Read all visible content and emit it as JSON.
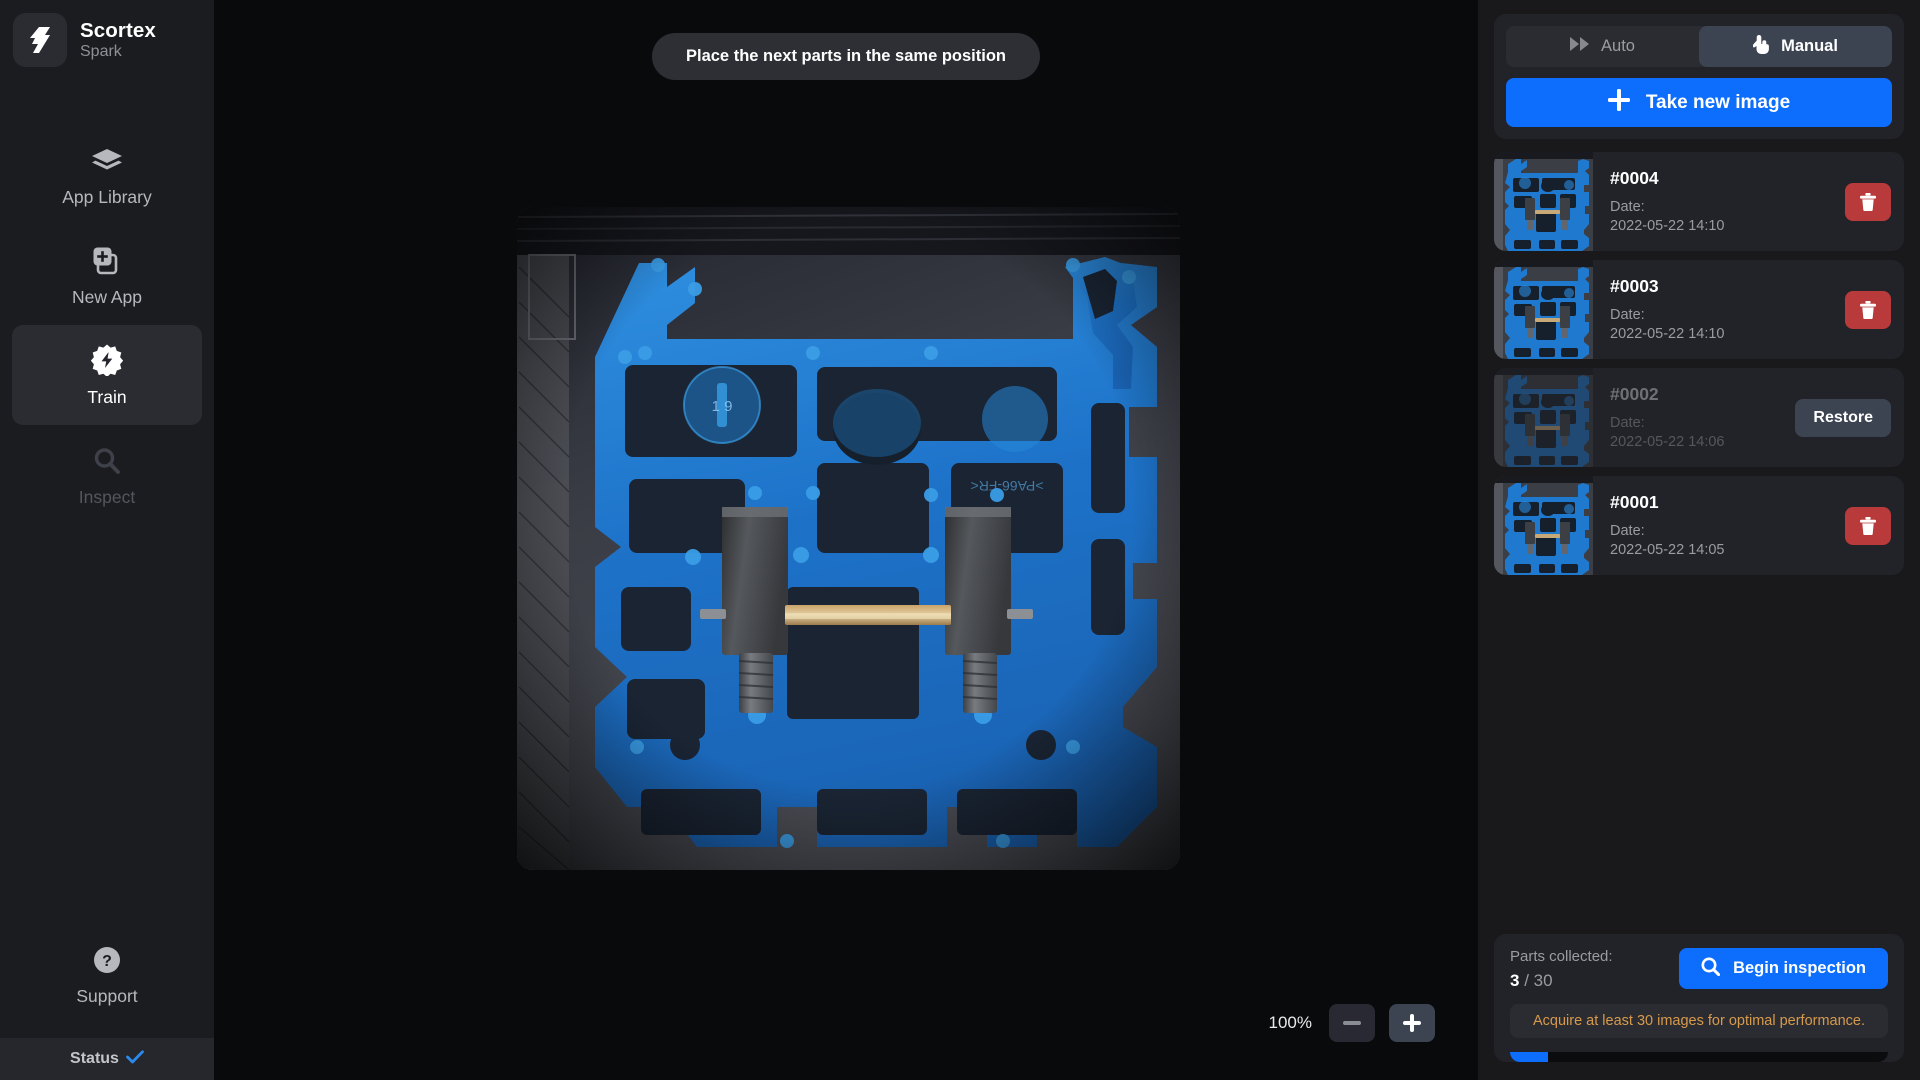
{
  "brand": {
    "name": "Scortex",
    "subtitle": "Spark",
    "logo_icon": "scortex-logo-icon"
  },
  "sidebar": {
    "items": [
      {
        "label": "App Library",
        "icon": "layers-icon",
        "state": "normal"
      },
      {
        "label": "New App",
        "icon": "new-app-icon",
        "state": "normal"
      },
      {
        "label": "Train",
        "icon": "spark-badge-icon",
        "state": "active"
      },
      {
        "label": "Inspect",
        "icon": "magnifier-icon",
        "state": "disabled"
      }
    ],
    "support": {
      "label": "Support",
      "icon": "question-circle-icon"
    },
    "status": {
      "label": "Status",
      "icon": "check-icon",
      "accent": "#2b8aee"
    }
  },
  "main": {
    "banner": "Place the next parts in the same position",
    "zoom": {
      "level": "100%",
      "zoom_out_label": "−",
      "zoom_in_label": "+"
    },
    "photo_alt": "blue-terminal-block-part"
  },
  "right": {
    "mode_toggle": {
      "options": [
        {
          "label": "Auto",
          "icon": "fast-forward-icon",
          "active": false
        },
        {
          "label": "Manual",
          "icon": "hand-pointer-icon",
          "active": true
        }
      ]
    },
    "take_image_button": {
      "label": "Take new image",
      "icon": "plus-icon"
    },
    "images": [
      {
        "id": "#0004",
        "date_label": "Date:",
        "date_value": "2022-05-22 14:10",
        "action": "delete",
        "action_label": "",
        "deleted": false
      },
      {
        "id": "#0003",
        "date_label": "Date:",
        "date_value": "2022-05-22 14:10",
        "action": "delete",
        "action_label": "",
        "deleted": false
      },
      {
        "id": "#0002",
        "date_label": "Date:",
        "date_value": "2022-05-22 14:06",
        "action": "restore",
        "action_label": "Restore",
        "deleted": true
      },
      {
        "id": "#0001",
        "date_label": "Date:",
        "date_value": "2022-05-22 14:05",
        "action": "delete",
        "action_label": "",
        "deleted": false
      }
    ],
    "footer": {
      "parts_label": "Parts collected:",
      "parts_current": "3",
      "parts_separator": " / ",
      "parts_total": "30",
      "inspect_button": {
        "label": "Begin inspection",
        "icon": "magnifier-icon"
      },
      "hint": "Acquire at least 30 images for optimal performance.",
      "progress_percent": 10,
      "progress_color": "#0d6efd",
      "hint_color": "#d79a4c"
    }
  },
  "colors": {
    "accent": "#0d6efd",
    "danger": "#b93a3a",
    "panel": "#222328",
    "sidebar": "#1b1c1f",
    "canvas": "#090a0c"
  }
}
